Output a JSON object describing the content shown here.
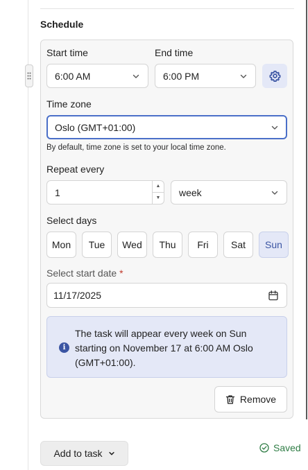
{
  "section": {
    "title": "Schedule"
  },
  "time": {
    "start_label": "Start time",
    "start_value": "6:00 AM",
    "end_label": "End time",
    "end_value": "6:00 PM"
  },
  "timezone": {
    "label": "Time zone",
    "value": "Oslo (GMT+01:00)",
    "hint": "By default, time zone is set to your local time zone."
  },
  "repeat": {
    "label": "Repeat every",
    "count": "1",
    "unit": "week"
  },
  "days": {
    "label": "Select days",
    "items": [
      "Mon",
      "Tue",
      "Wed",
      "Thu",
      "Fri",
      "Sat",
      "Sun"
    ],
    "selected": "Sun"
  },
  "start_date": {
    "label": "Select start date",
    "required_mark": "*",
    "value": "11/17/2025"
  },
  "info": {
    "text": "The task will appear every week on Sun starting on November 17 at 6:00 AM Oslo (GMT+01:00)."
  },
  "actions": {
    "remove_label": "Remove",
    "add_label": "Add to task",
    "saved_label": "Saved"
  },
  "colors": {
    "accent": "#3b55a3",
    "accent_bg": "#e4e8f7",
    "success": "#2f7d45",
    "required": "#c0392b"
  },
  "icons": [
    "drag-handle-icon",
    "chevron-down-icon",
    "gear-icon",
    "calendar-icon",
    "info-icon",
    "trash-icon",
    "check-circle-icon"
  ]
}
